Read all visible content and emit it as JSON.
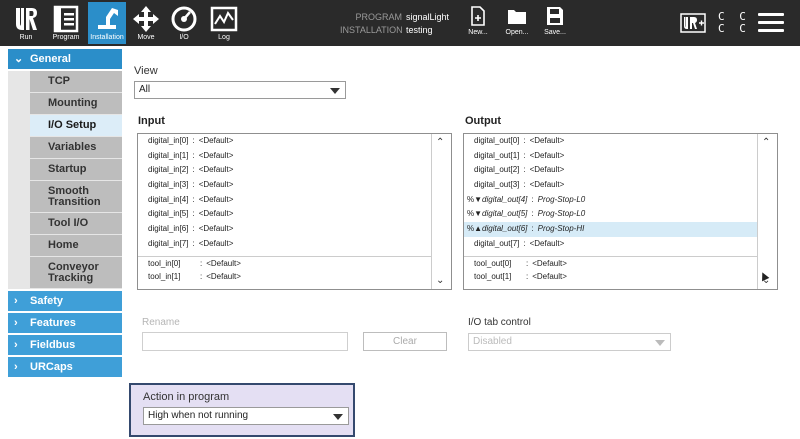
{
  "topbar": {
    "run_label": "Run",
    "program_label": "Program",
    "installation_label": "Installation",
    "move_label": "Move",
    "io_label": "I/O",
    "log_label": "Log",
    "program_key": "PROGRAM",
    "program_value": "signalLight",
    "installation_key": "INSTALLATION",
    "installation_value": "testing",
    "new_label": "New...",
    "open_label": "Open...",
    "save_label": "Save...",
    "cc_line1": "C C",
    "cc_line2": "C C"
  },
  "sidebar": {
    "general": "General",
    "items": [
      {
        "label": "TCP"
      },
      {
        "label": "Mounting"
      },
      {
        "label": "I/O Setup"
      },
      {
        "label": "Variables"
      },
      {
        "label": "Startup"
      },
      {
        "label": "Smooth Transition"
      },
      {
        "label": "Tool I/O"
      },
      {
        "label": "Home"
      },
      {
        "label": "Conveyor Tracking"
      }
    ],
    "safety": "Safety",
    "features": "Features",
    "fieldbus": "Fieldbus",
    "urcaps": "URCaps"
  },
  "view": {
    "label": "View",
    "selected": "All"
  },
  "input": {
    "title": "Input",
    "rows": [
      {
        "name": "digital_in[0]",
        "sep": ":",
        "value": "<Default>"
      },
      {
        "name": "digital_in[1]",
        "sep": ":",
        "value": "<Default>"
      },
      {
        "name": "digital_in[2]",
        "sep": ":",
        "value": "<Default>"
      },
      {
        "name": "digital_in[3]",
        "sep": ":",
        "value": "<Default>"
      },
      {
        "name": "digital_in[4]",
        "sep": ":",
        "value": "<Default>"
      },
      {
        "name": "digital_in[5]",
        "sep": ":",
        "value": "<Default>"
      },
      {
        "name": "digital_in[6]",
        "sep": ":",
        "value": "<Default>"
      },
      {
        "name": "digital_in[7]",
        "sep": ":",
        "value": "<Default>"
      },
      {
        "name": "tool_in[0]",
        "sep": ":",
        "value": "<Default>"
      },
      {
        "name": "tool_in[1]",
        "sep": ":",
        "value": "<Default>"
      }
    ]
  },
  "output": {
    "title": "Output",
    "rows": [
      {
        "prefix": "",
        "name": "digital_out[0]",
        "sep": ":",
        "value": "<Default>"
      },
      {
        "prefix": "",
        "name": "digital_out[1]",
        "sep": ":",
        "value": "<Default>"
      },
      {
        "prefix": "",
        "name": "digital_out[2]",
        "sep": ":",
        "value": "<Default>"
      },
      {
        "prefix": "",
        "name": "digital_out[3]",
        "sep": ":",
        "value": "<Default>"
      },
      {
        "prefix": "%▼",
        "name": "digital_out[4]",
        "sep": ":",
        "value": "Prog-Stop-L0"
      },
      {
        "prefix": "%▼",
        "name": "digital_out[5]",
        "sep": ":",
        "value": "Prog-Stop-L0"
      },
      {
        "prefix": "%▲",
        "name": "digital_out[6]",
        "sep": ":",
        "value": "Prog-Stop-HI"
      },
      {
        "prefix": "",
        "name": "digital_out[7]",
        "sep": ":",
        "value": "<Default>"
      },
      {
        "prefix": "",
        "name": "tool_out[0]",
        "sep": ":",
        "value": "<Default>"
      },
      {
        "prefix": "",
        "name": "tool_out[1]",
        "sep": ":",
        "value": "<Default>"
      }
    ]
  },
  "rename": {
    "label": "Rename",
    "value": "",
    "clear_label": "Clear"
  },
  "io_tab": {
    "label": "I/O tab control",
    "selected": "Disabled"
  },
  "action": {
    "label": "Action in program",
    "selected": "High when not running"
  },
  "colors": {
    "accent": "#2b8ec9",
    "sidebar_category": "#3f9fd8",
    "selected_row": "#d6ebf7",
    "action_highlight": "#e4dff3",
    "action_border": "#34496e"
  }
}
